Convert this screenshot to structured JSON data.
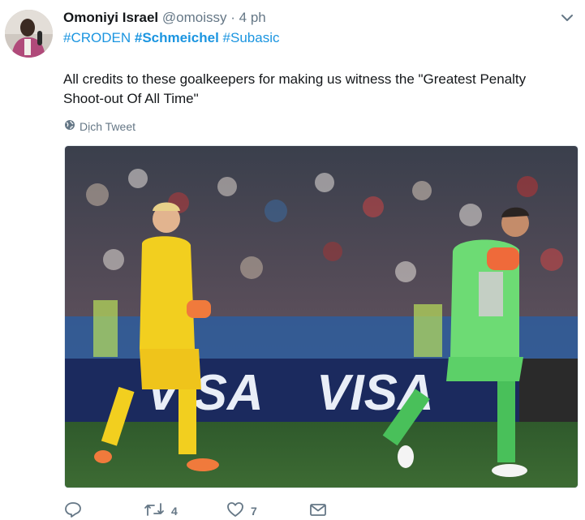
{
  "tweet": {
    "author_name": "Omoniyi Israel",
    "handle": "@omoissy",
    "separator": "·",
    "time": "4 ph",
    "hashtags": [
      {
        "text": "#CRODEN",
        "bold": false
      },
      {
        "text": "#Schmeichel",
        "bold": true
      },
      {
        "text": "#Subasic",
        "bold": false
      }
    ],
    "body": "All credits to these goalkeepers for making us witness the \"Greatest Penalty Shoot-out Of All Time\"",
    "translate_label": "Dịch Tweet",
    "photo_banner_text": [
      "VISA",
      "VISA"
    ],
    "actions": {
      "reply_count": "",
      "retweet_count": "4",
      "like_count": "7",
      "dm_count": ""
    }
  },
  "colors": {
    "link": "#1b95e0",
    "secondary_text": "#657786",
    "primary_text": "#14171a"
  },
  "icons": [
    "chevron-down-icon",
    "globe-icon",
    "reply-icon",
    "retweet-icon",
    "heart-icon",
    "message-icon"
  ]
}
